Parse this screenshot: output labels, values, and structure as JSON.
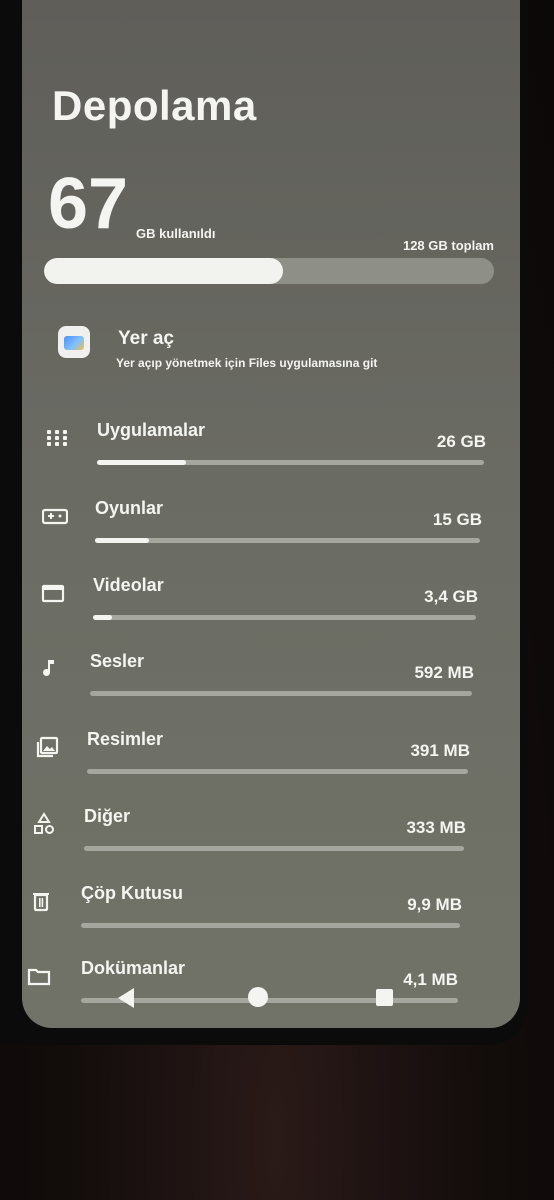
{
  "header": {
    "title": "Depolama"
  },
  "storage": {
    "used_value": "67",
    "used_unit": "GB kullanıldı",
    "total": "128 GB toplam",
    "used_fraction": 0.53
  },
  "free_up": {
    "title": "Yer aç",
    "subtitle": "Yer açıp yönetmek için Files uygulamasına git",
    "icon": "files-app-icon"
  },
  "categories": [
    {
      "label": "Uygulamalar",
      "size": "26 GB",
      "fraction": 0.23,
      "icon": "apps-grid-icon"
    },
    {
      "label": "Oyunlar",
      "size": "15 GB",
      "fraction": 0.14,
      "icon": "gamepad-icon"
    },
    {
      "label": "Videolar",
      "size": "3,4 GB",
      "fraction": 0.05,
      "icon": "video-icon"
    },
    {
      "label": "Sesler",
      "size": "592 MB",
      "fraction": 0.0,
      "icon": "music-note-icon"
    },
    {
      "label": "Resimler",
      "size": "391 MB",
      "fraction": 0.0,
      "icon": "images-icon"
    },
    {
      "label": "Diğer",
      "size": "333 MB",
      "fraction": 0.0,
      "icon": "shapes-icon"
    },
    {
      "label": "Çöp Kutusu",
      "size": "9,9 MB",
      "fraction": 0.0,
      "icon": "trash-icon"
    },
    {
      "label": "Dokümanlar",
      "size": "4,1 MB",
      "fraction": 0.0,
      "icon": "folder-icon"
    }
  ],
  "colors": {
    "background": "#6a6b63",
    "bar_fill": "#f2f2ee",
    "bar_track": "#a5a69d"
  }
}
